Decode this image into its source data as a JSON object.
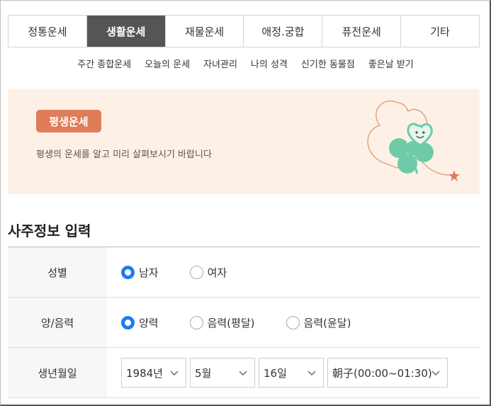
{
  "tabs": [
    {
      "label": "정통운세"
    },
    {
      "label": "생활운세"
    },
    {
      "label": "재물운세"
    },
    {
      "label": "애정.궁합"
    },
    {
      "label": "퓨전운세"
    },
    {
      "label": "기타"
    }
  ],
  "active_tab": "생활운세",
  "subnav": [
    {
      "label": "주간 종합운세"
    },
    {
      "label": "오늘의 운세"
    },
    {
      "label": "자녀관리"
    },
    {
      "label": "나의 성격"
    },
    {
      "label": "신기한 동물점"
    },
    {
      "label": "좋은날 받기"
    }
  ],
  "banner": {
    "badge": "평생운세",
    "description": "평생의 운세를 알고 미리 살펴보시기 바랍니다"
  },
  "section_title": "사주정보 입력",
  "form": {
    "gender": {
      "label": "성별",
      "options": [
        "남자",
        "여자"
      ],
      "selected": "남자"
    },
    "calendar": {
      "label": "양/음력",
      "options": [
        "양력",
        "음력(평달)",
        "음력(윤달)"
      ],
      "selected": "양력"
    },
    "birth": {
      "label": "생년월일",
      "year": "1984년",
      "month": "5월",
      "day": "16일",
      "time": "朝子(00:00~01:30)"
    }
  },
  "colors": {
    "active_tab_bg": "#555555",
    "badge": "#e07c5a",
    "banner_bg": "#fdf1e7",
    "radio_accent": "#1e7bf0",
    "clover": "#6fcaa8"
  }
}
